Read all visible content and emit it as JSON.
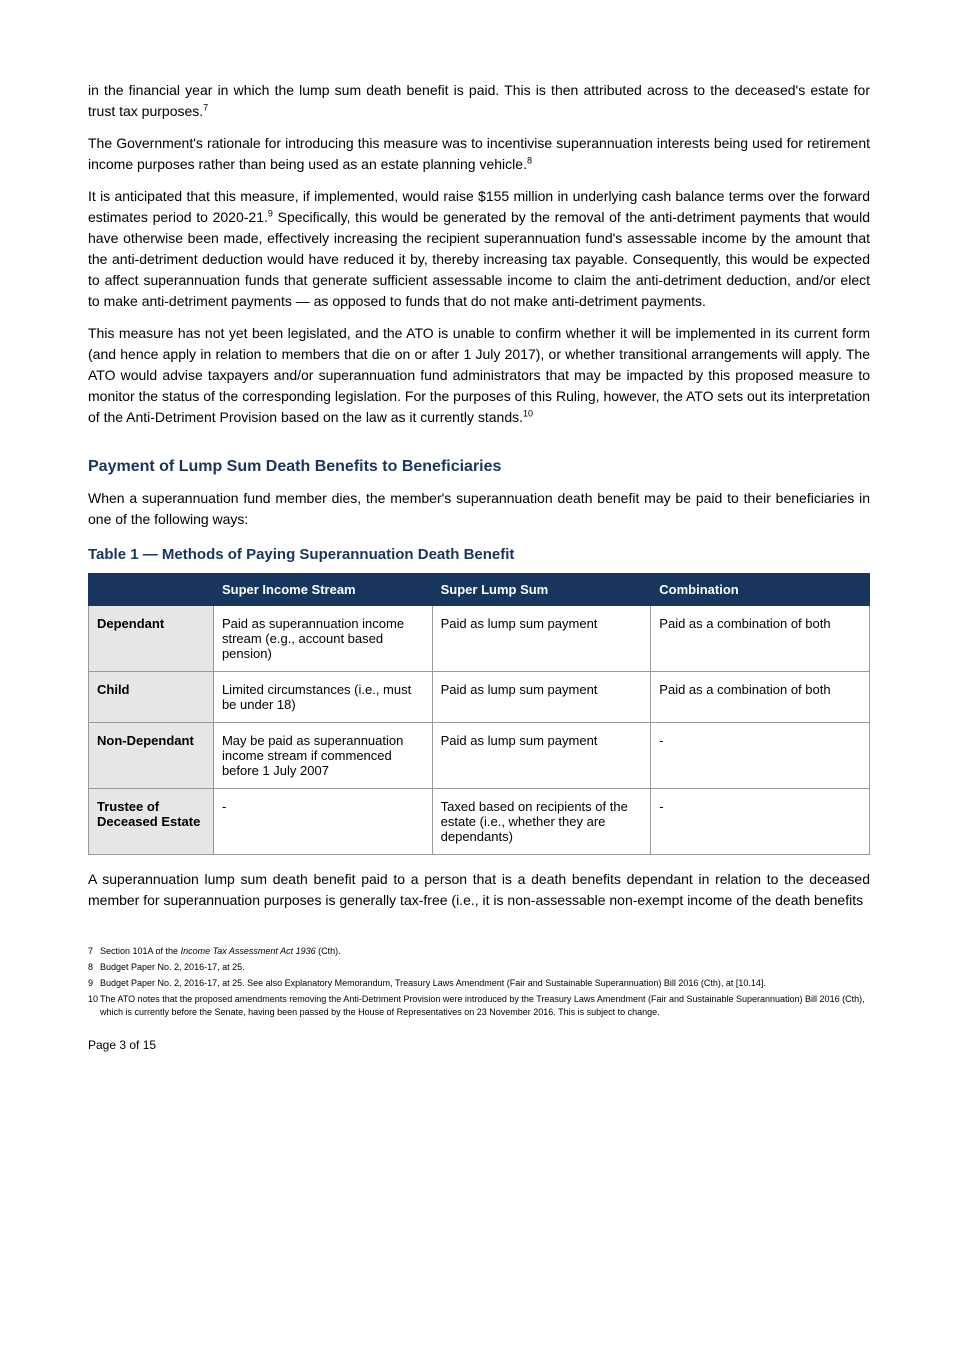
{
  "paragraphs": {
    "p0": "in the financial year in which the lump sum death benefit is paid. This is then attributed across to the deceased's estate for trust tax purposes.",
    "p0_sup": "7",
    "p1": "The Government's rationale for introducing this measure was to incentivise superannuation interests being used for retirement income purposes rather than being used as an estate planning vehicle.",
    "p1_sup": "8",
    "p2_pre": "It is anticipated that this measure, if implemented, would raise $155 million in underlying cash balance terms over the forward estimates period to 2020-21.",
    "p2_sup": "9",
    "p2_post": " Specifically, this would be generated by the removal of the anti-detriment payments that would have otherwise been made, effectively increasing the recipient superannuation fund's assessable income by the amount that the anti-detriment deduction would have reduced it by, thereby increasing tax payable. Consequently, this would be expected to affect superannuation funds that generate sufficient assessable income to claim the anti-detriment deduction, and/or elect to make anti-detriment payments — as opposed to funds that do not make anti-detriment payments.",
    "p3": "This measure has not yet been legislated, and the ATO is unable to confirm whether it will be implemented in its current form (and hence apply in relation to members that die on or after 1 July 2017), or whether transitional arrangements will apply. The ATO would advise taxpayers and/or superannuation fund administrators that may be impacted by this proposed measure to monitor the status of the corresponding legislation. For the purposes of this Ruling, however, the ATO sets out its interpretation of the Anti-Detriment Provision based on the law as it currently stands.",
    "p3_sup": "10"
  },
  "heading_payment": "Payment of Lump Sum Death Benefits to Beneficiaries",
  "intro_after_heading": "When a superannuation fund member dies, the member's superannuation death benefit may be paid to their beneficiaries in one of the following ways:",
  "subheading_table": "Table 1 — Methods of Paying Superannuation Death Benefit",
  "table": {
    "headers": [
      "",
      "Super Income Stream",
      "Super Lump Sum",
      "Combination"
    ],
    "rows": [
      {
        "label": "Dependant",
        "c1": "Paid as superannuation income stream (e.g., account based pension)",
        "c2": "Paid as lump sum payment",
        "c3": "Paid as a combination of both"
      },
      {
        "label": "Child",
        "c1": "Limited circumstances (i.e., must be under 18)",
        "c2": "Paid as lump sum payment",
        "c3": "Paid as a combination of both"
      },
      {
        "label": "Non-Dependant",
        "c1": "May be paid as superannuation income stream if commenced before 1 July 2007",
        "c2": "Paid as lump sum payment",
        "c3": "-"
      },
      {
        "label": "Trustee of Deceased Estate",
        "c1": "-",
        "c2": "Taxed based on recipients of the estate (i.e., whether they are dependants)",
        "c3": "-"
      }
    ]
  },
  "after_table": "A superannuation lump sum death benefit paid to a person that is a death benefits dependant in relation to the deceased member for superannuation purposes is generally tax-free (i.e., it is non-assessable non-exempt income of the death benefits",
  "footnotes": [
    {
      "n": "7",
      "text": "Section 101A of the ",
      "em": "Income Tax Assessment Act 1936",
      "tail": " (Cth)."
    },
    {
      "n": "8",
      "text": "Budget Paper No. 2, 2016-17, at 25."
    },
    {
      "n": "9",
      "text": "Budget Paper No. 2, 2016-17, at 25. See also Explanatory Memorandum, Treasury Laws Amendment (Fair and Sustainable Superannuation) Bill 2016 (Cth), at [10.14]."
    },
    {
      "n": "10",
      "text": "The ATO notes that the proposed amendments removing the Anti-Detriment Provision were introduced by the Treasury Laws Amendment (Fair and Sustainable Superannuation) Bill 2016 (Cth), which is currently before the Senate, having been passed by the House of Representatives on 23 November 2016. This is subject to change."
    }
  ],
  "footer": "Page 3 of 15"
}
